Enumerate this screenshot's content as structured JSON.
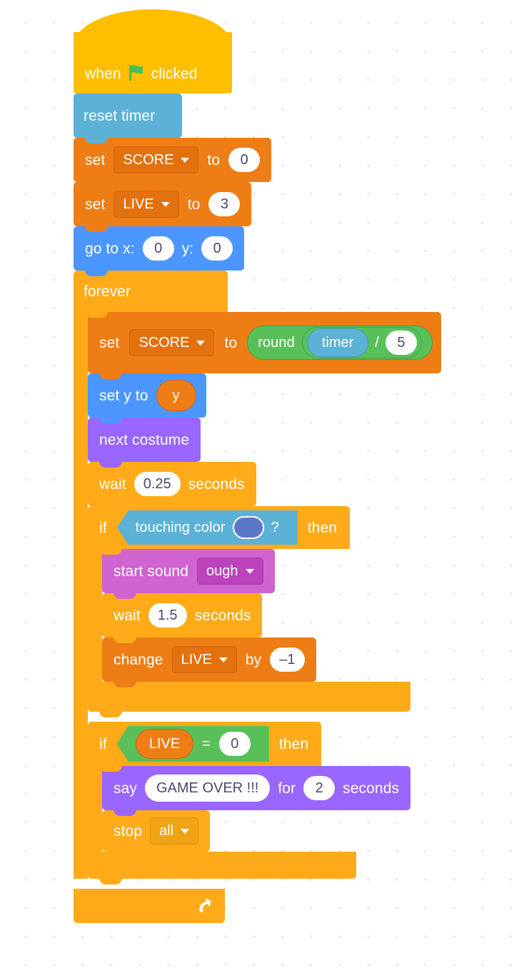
{
  "canvas": {
    "background": "#ffffff",
    "dot_color": "#e6e6ec",
    "title": "Scratch block script editor"
  },
  "palette": {
    "events": "#FFBF00",
    "sensing": "#5CB1D6",
    "variables": "#EE7D16",
    "motion": "#4C97FF",
    "control": "#FFAB19",
    "looks": "#9966FF",
    "sound": "#CF63CF",
    "operators": "#59C059",
    "input_white": "#FFFFFF",
    "input_text": "#4A4A6A",
    "touching_color_swatch": "#5C77C8",
    "flag_green": "#45BF55"
  },
  "script": {
    "hat": {
      "word_when": "when",
      "icon": "green-flag-icon",
      "word_clicked": "clicked"
    },
    "reset_timer": {
      "label": "reset timer"
    },
    "set_score": {
      "word_set": "set",
      "variable": "SCORE",
      "word_to": "to",
      "value": "0"
    },
    "set_live": {
      "word_set": "set",
      "variable": "LIVE",
      "word_to": "to",
      "value": "3"
    },
    "go_to_xy": {
      "word_go_to_x": "go to x:",
      "x": "0",
      "word_y": "y:",
      "y": "0"
    },
    "forever": {
      "label": "forever",
      "set_score_round": {
        "word_set": "set",
        "variable": "SCORE",
        "word_to": "to",
        "word_round": "round",
        "timer": "timer",
        "operator": "/",
        "divisor": "5"
      },
      "set_y_to": {
        "label": "set y to",
        "variable": "y"
      },
      "next_costume": {
        "label": "next costume"
      },
      "wait_quarter": {
        "word_wait": "wait",
        "value": "0.25",
        "word_seconds": "seconds"
      },
      "if_touching_color": {
        "word_if": "if",
        "condition_label": "touching color",
        "question_mark": "?",
        "word_then": "then",
        "start_sound": {
          "word_start_sound": "start sound",
          "sound": "ough"
        },
        "wait": {
          "word_wait": "wait",
          "value": "1.5",
          "word_seconds": "seconds"
        },
        "change_live": {
          "word_change": "change",
          "variable": "LIVE",
          "word_by": "by",
          "value": "–1"
        }
      },
      "if_live_zero": {
        "word_if": "if",
        "variable": "LIVE",
        "operator": "=",
        "value": "0",
        "word_then": "then",
        "say": {
          "word_say": "say",
          "message": "GAME OVER !!!",
          "word_for": "for",
          "value": "2",
          "word_seconds": "seconds"
        },
        "stop": {
          "word_stop": "stop",
          "target": "all"
        }
      }
    }
  }
}
